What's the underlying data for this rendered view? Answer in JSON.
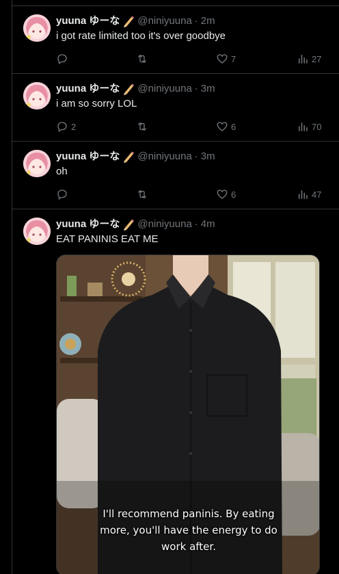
{
  "tweets": [
    {
      "author": "yuuna ゆーな",
      "handle": "@niniyuuna",
      "separator": "·",
      "time": "2m",
      "text": "i got rate limited too it's over goodbye",
      "replies": "",
      "likes": "7",
      "views": "27"
    },
    {
      "author": "yuuna ゆーな",
      "handle": "@niniyuuna",
      "separator": "·",
      "time": "3m",
      "text": "i am so sorry LOL",
      "replies": "2",
      "likes": "6",
      "views": "70"
    },
    {
      "author": "yuuna ゆーな",
      "handle": "@niniyuuna",
      "separator": "·",
      "time": "3m",
      "text": "oh",
      "replies": "",
      "likes": "6",
      "views": "47"
    },
    {
      "author": "yuuna ゆーな",
      "handle": "@niniyuuna",
      "separator": "·",
      "time": "4m",
      "text": "EAT PANINIS EAT ME",
      "media": {
        "subtitle_lines": [
          "I'll recommend paninis. By eating",
          "more, you'll have the energy to do",
          "work after."
        ]
      }
    }
  ],
  "colors": {
    "background": "#000000",
    "text": "#e7e9ea",
    "muted": "#71767b",
    "divider": "#2f3336"
  }
}
